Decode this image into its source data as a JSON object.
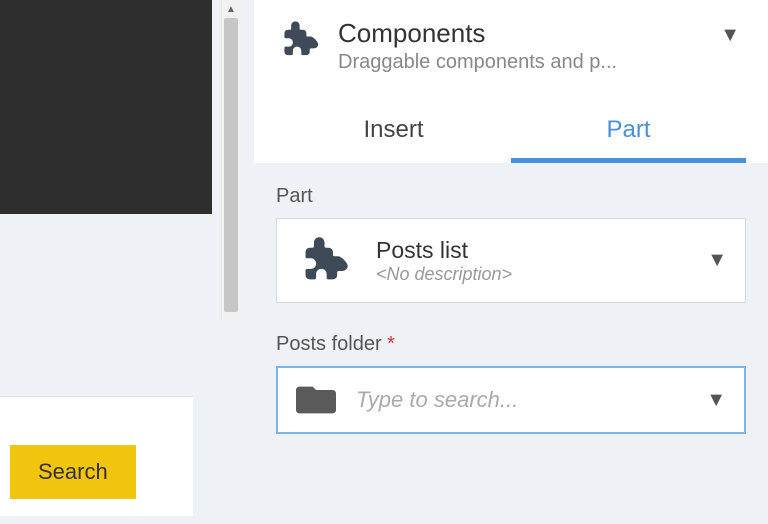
{
  "header": {
    "title": "Components",
    "subtitle": "Draggable components and p..."
  },
  "tabs": {
    "insert": "Insert",
    "part": "Part"
  },
  "partSection": {
    "label": "Part",
    "title": "Posts list",
    "subtitle": "<No description>"
  },
  "folderSection": {
    "label": "Posts folder",
    "required": "*",
    "placeholder": "Type to search..."
  },
  "search": {
    "button": "Search"
  }
}
